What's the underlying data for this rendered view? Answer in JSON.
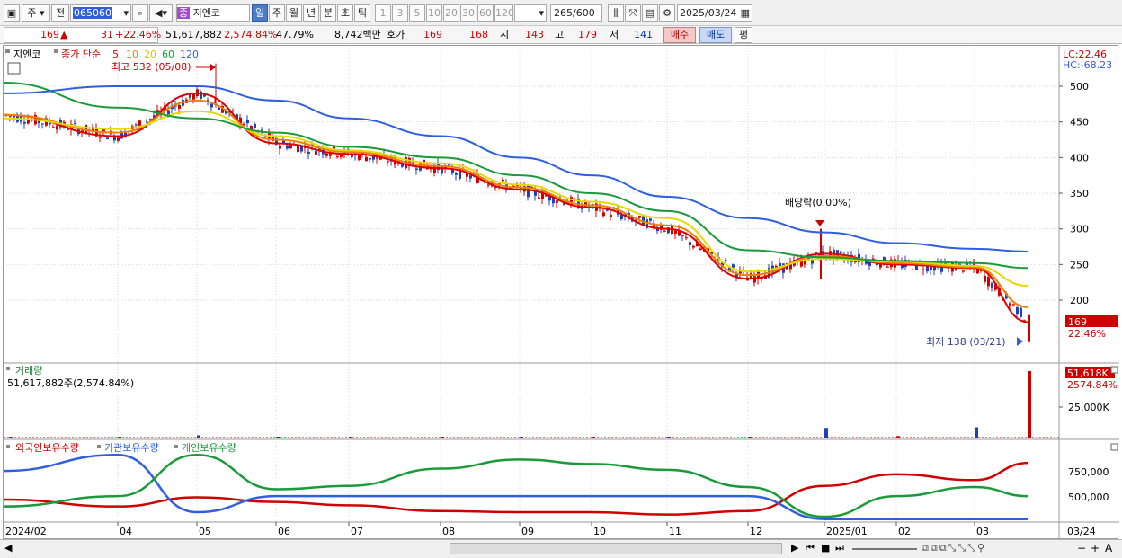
{
  "toolbar": {
    "period_options": [
      "주",
      "전"
    ],
    "code_value": "065060",
    "stock_name": "지엔코",
    "stock_tag": "종",
    "timeframes": [
      {
        "label": "일",
        "selected": true
      },
      {
        "label": "주",
        "selected": false
      },
      {
        "label": "월",
        "selected": false
      },
      {
        "label": "년",
        "selected": false
      },
      {
        "label": "분",
        "selected": false
      },
      {
        "label": "초",
        "selected": false
      },
      {
        "label": "틱",
        "selected": false
      }
    ],
    "intervals": [
      "1",
      "3",
      "5",
      "10",
      "20",
      "30",
      "60",
      "120"
    ],
    "count_value": "265",
    "count_total": "/600",
    "date_value": "2025/03/24"
  },
  "quote": {
    "price": "169",
    "direction_icon": "▲",
    "change": "31",
    "change_pct": "+22.46%",
    "volume": "51,617,882",
    "volume_pct": "2,574.84%",
    "turnover_pct": "47.79%",
    "amount": "8,742백만",
    "hoga_label": "호가",
    "bid": "169",
    "ask": "168",
    "open_label": "시",
    "open": "143",
    "high_label": "고",
    "high": "179",
    "low_label": "저",
    "low": "141",
    "buy_label": "매수",
    "sell_label": "매도",
    "avg_label": "평"
  },
  "price_panel": {
    "stock_label": "지엔코",
    "ma_prefix": "종가 단순",
    "ma_periods": [
      "5",
      "10",
      "20",
      "60",
      "120"
    ],
    "ma_colors": [
      "#e00000",
      "#f08000",
      "#e8d800",
      "#1a9a3a",
      "#2f5fe0"
    ],
    "lc_label": "LC:22.46",
    "hc_label": "HC:-68.23",
    "high_annotation": "최고 532 (05/08)",
    "low_annotation": "최저 138 (03/21)",
    "dividend_annotation": "배당락(0.00%)",
    "price_tag": "169",
    "pct_tag": "22.46%",
    "y_ticks": [
      "500",
      "450",
      "400",
      "350",
      "300",
      "250",
      "200"
    ]
  },
  "volume_panel": {
    "title": "거래량",
    "subtitle": "51,617,882주(2,574.84%)",
    "vol_tag": "51,618K",
    "pct_tag": "2574.84%",
    "y_ticks": [
      "25,000K"
    ]
  },
  "holdings_panel": {
    "legend": [
      {
        "name": "외국인보유수량",
        "color": "#d00000"
      },
      {
        "name": "기관보유수량",
        "color": "#2f5fe0"
      },
      {
        "name": "개인보유수량",
        "color": "#1a9a3a"
      }
    ],
    "y_ticks": [
      "750,000",
      "500,000"
    ]
  },
  "x_axis": {
    "labels": [
      "2024/02",
      "04",
      "05",
      "06",
      "07",
      "08",
      "09",
      "10",
      "11",
      "12",
      "2025/01",
      "02",
      "03"
    ],
    "last_label": "03/24"
  },
  "chart_data": [
    {
      "type": "line",
      "title": "지엔코",
      "x": [
        "2024/02",
        "04",
        "05",
        "06",
        "07",
        "08",
        "09",
        "10",
        "11",
        "12",
        "2025/01",
        "02",
        "03",
        "03/24"
      ],
      "ylim": [
        170,
        540
      ],
      "series": [
        {
          "name": "종가 단순 5",
          "values": [
            460,
            430,
            490,
            420,
            405,
            385,
            355,
            330,
            300,
            230,
            265,
            250,
            245,
            169
          ]
        },
        {
          "name": "종가 단순 10",
          "values": [
            460,
            435,
            480,
            425,
            408,
            388,
            358,
            333,
            305,
            235,
            262,
            252,
            246,
            190
          ]
        },
        {
          "name": "종가 단순 20",
          "values": [
            455,
            440,
            465,
            430,
            410,
            392,
            362,
            338,
            315,
            240,
            258,
            254,
            248,
            220
          ]
        },
        {
          "name": "종가 단순 60",
          "values": [
            505,
            470,
            455,
            435,
            415,
            400,
            375,
            350,
            325,
            270,
            260,
            255,
            252,
            245
          ]
        },
        {
          "name": "종가 단순 120",
          "values": [
            490,
            500,
            500,
            480,
            455,
            430,
            400,
            375,
            345,
            315,
            295,
            280,
            272,
            268
          ]
        }
      ],
      "annotations": {
        "high": 532,
        "low": 138,
        "last": 169
      }
    },
    {
      "type": "bar",
      "title": "거래량",
      "x": [
        "2024/02",
        "04",
        "05",
        "06",
        "07",
        "08",
        "09",
        "10",
        "11",
        "12",
        "2025/01",
        "02",
        "03",
        "03/24"
      ],
      "series": [
        {
          "name": "거래량",
          "values": [
            400,
            500,
            1800,
            600,
            400,
            300,
            350,
            300,
            400,
            500,
            7500,
            1200,
            8000,
            51618
          ]
        }
      ],
      "unit": "K"
    },
    {
      "type": "line",
      "title": "보유수량",
      "x": [
        "2024/02",
        "04",
        "05",
        "06",
        "07",
        "08",
        "09",
        "10",
        "11",
        "12",
        "2025/01",
        "02",
        "03",
        "03/24"
      ],
      "ylim": [
        350000,
        1000000
      ],
      "series": [
        {
          "name": "외국인보유수량",
          "values": [
            530000,
            470000,
            550000,
            510000,
            480000,
            430000,
            420000,
            420000,
            400000,
            430000,
            650000,
            750000,
            700000,
            850000
          ]
        },
        {
          "name": "기관보유수량",
          "values": [
            780000,
            920000,
            420000,
            560000,
            560000,
            560000,
            560000,
            560000,
            560000,
            560000,
            360000,
            360000,
            360000,
            360000
          ]
        },
        {
          "name": "개인보유수량",
          "values": [
            470000,
            560000,
            920000,
            620000,
            650000,
            800000,
            880000,
            840000,
            790000,
            640000,
            380000,
            560000,
            640000,
            560000
          ]
        }
      ]
    }
  ]
}
